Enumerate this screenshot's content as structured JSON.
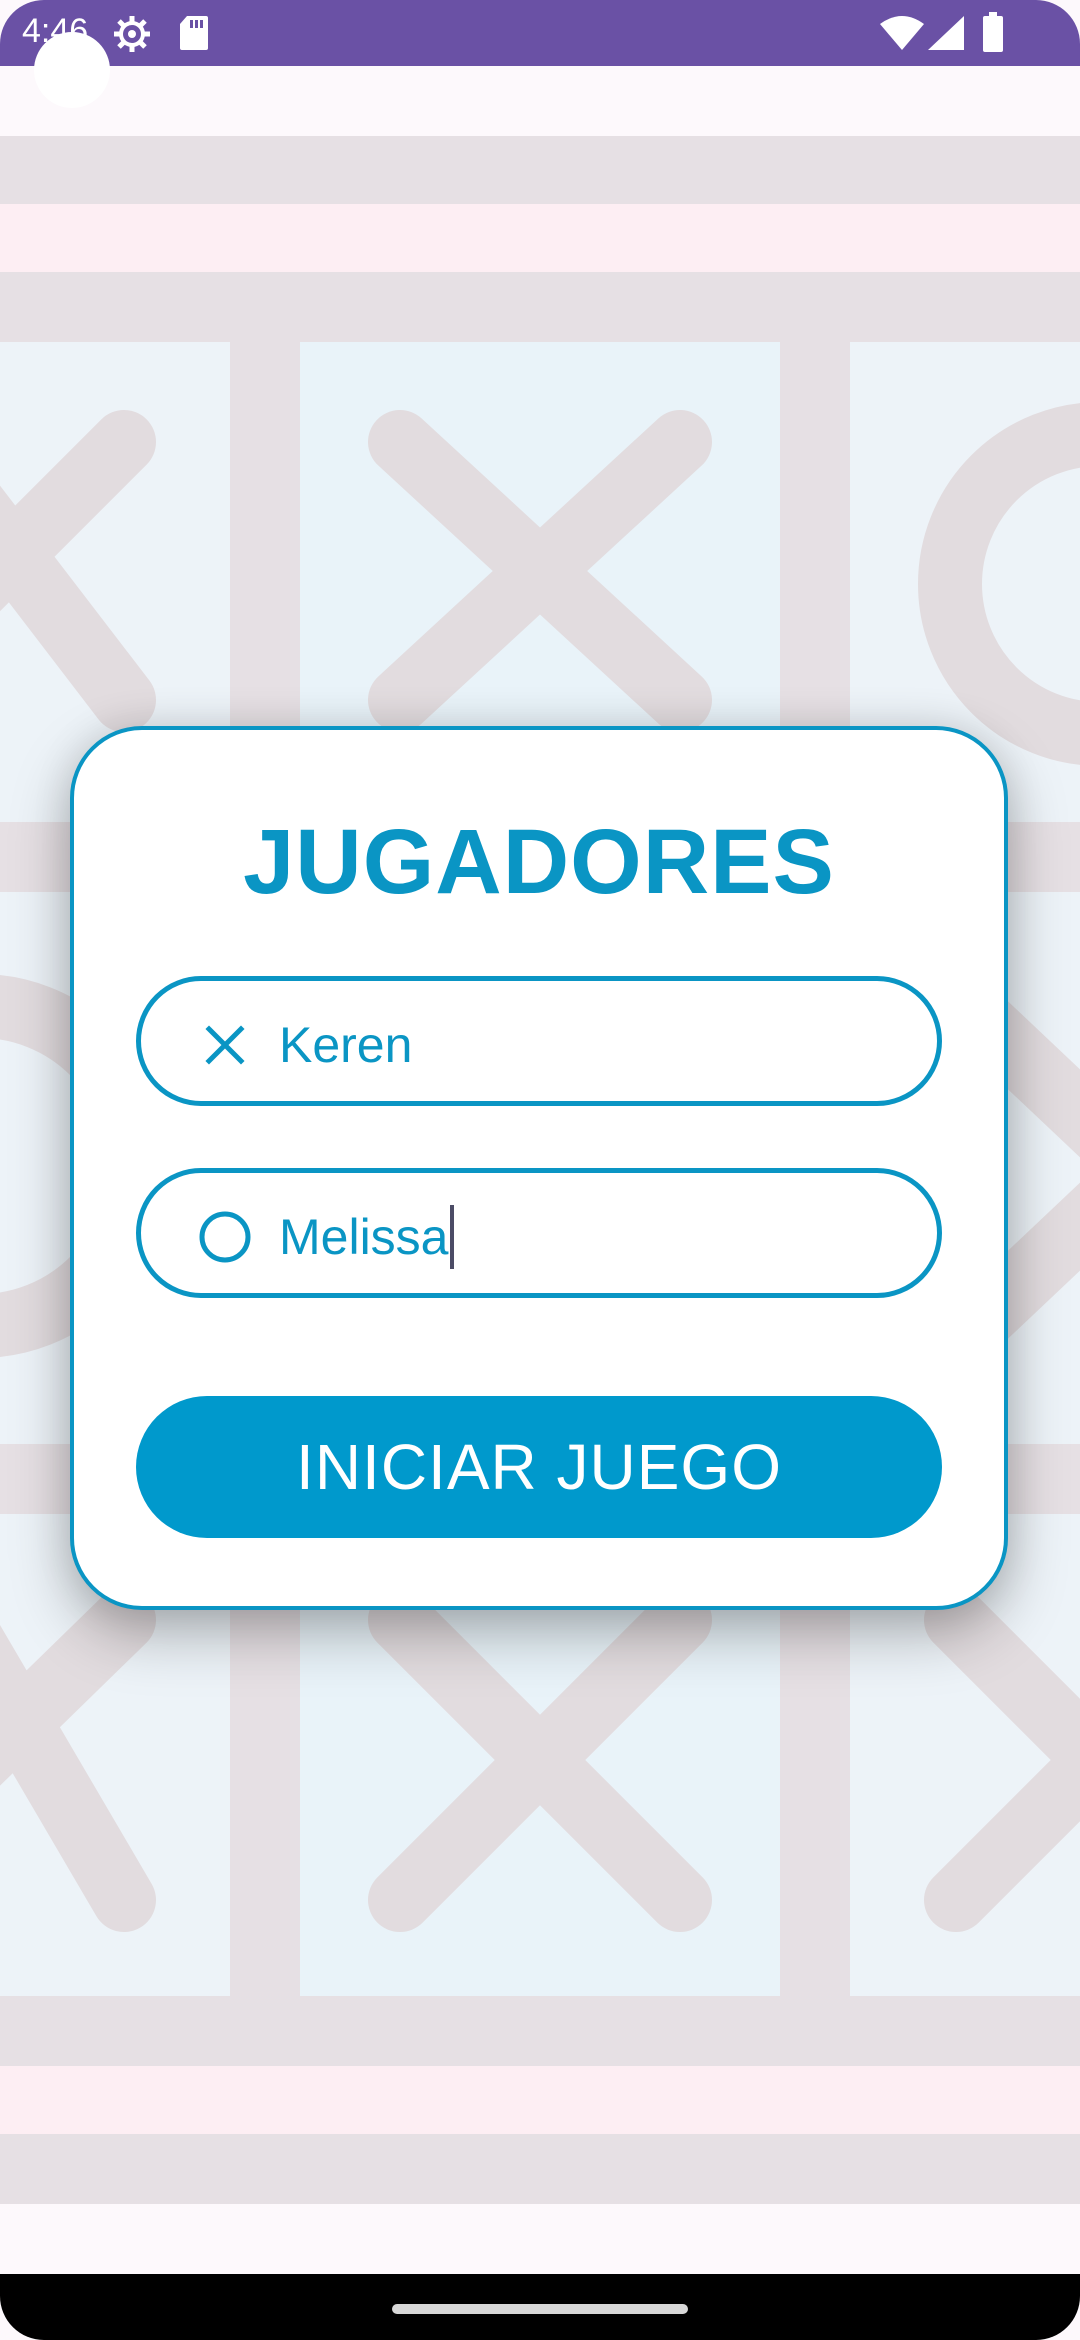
{
  "status_bar": {
    "time": "4:46",
    "icons": [
      "gear-icon",
      "sd-card-icon",
      "wifi-icon",
      "signal-icon",
      "battery-icon"
    ]
  },
  "card": {
    "title": "JUGADORES",
    "player1": {
      "icon": "x-mark-icon",
      "value": "Keren"
    },
    "player2": {
      "icon": "circle-mark-icon",
      "value": "Melissa"
    },
    "start_button": "INICIAR JUEGO"
  },
  "colors": {
    "accent": "#0a95c4",
    "button": "#0099cc",
    "status_bar": "#6a51a5",
    "board_lines": "#e5e0e3",
    "board_marks": "#e3dfe2",
    "cell_fill": "#edf3f8"
  }
}
